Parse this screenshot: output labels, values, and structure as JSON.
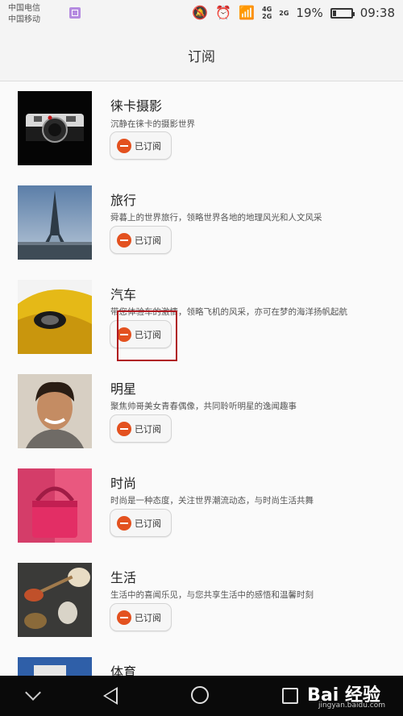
{
  "status": {
    "carrier1": "中国电信",
    "carrier2": "中国移动",
    "net_a_top": "4G",
    "net_a_bottom": "2G",
    "net_b_top": "2G",
    "battery": "19%",
    "battery_level": 0.19,
    "time": "09:38",
    "icons": [
      "mute-icon",
      "alarm-icon",
      "wifi-icon",
      "signal-icon",
      "battery-icon"
    ]
  },
  "header": {
    "title": "订阅"
  },
  "subscriptions": [
    {
      "title": "徕卡摄影",
      "description": "沉静在徕卡的摄影世界",
      "button": "已订阅"
    },
    {
      "title": "旅行",
      "description": "舜暮上的世界旅行，领略世界各地的地理风光和人文风采",
      "button": "已订阅"
    },
    {
      "title": "汽车",
      "description": "带您体验车的激情，领略飞机的风采，亦可在梦的海洋扬帆起航",
      "button": "已订阅"
    },
    {
      "title": "明星",
      "description": "聚焦帅哥美女青春偶像，共同聆听明星的逸闻趣事",
      "button": "已订阅"
    },
    {
      "title": "时尚",
      "description": "时尚是一种态度，关注世界潮流动态，与时尚生活共舞",
      "button": "已订阅"
    },
    {
      "title": "生活",
      "description": "生活中的喜闻乐见，与您共享生活中的感悟和温馨时刻",
      "button": "已订阅"
    },
    {
      "title": "体育",
      "description": "",
      "button": ""
    }
  ],
  "colors": {
    "accent": "#e3511f",
    "highlight": "#b0181f",
    "navbar": "#0a0a0a"
  },
  "watermark": {
    "logo": "Bai 经验",
    "url": "jingyan.baidu.com"
  }
}
